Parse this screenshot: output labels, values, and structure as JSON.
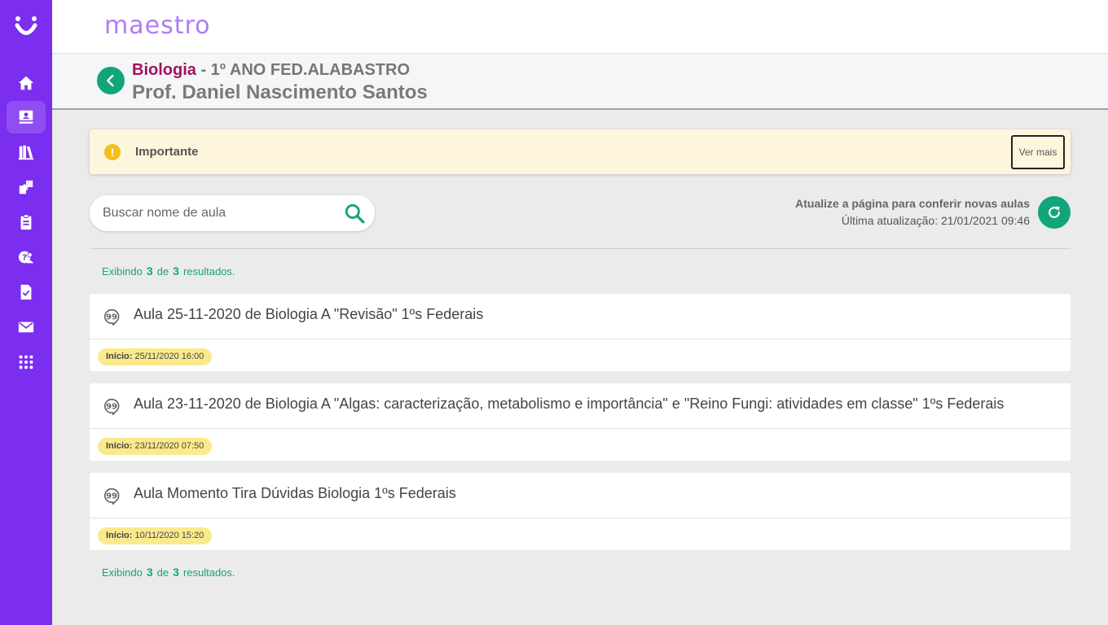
{
  "app": {
    "brand": "maestro"
  },
  "sidebar": {
    "items": [
      {
        "icon": "home-icon"
      },
      {
        "icon": "teacher-board-icon",
        "active": true
      },
      {
        "icon": "library-icon"
      },
      {
        "icon": "puzzle-icon"
      },
      {
        "icon": "clipboard-icon"
      },
      {
        "icon": "mentor-icon"
      },
      {
        "icon": "checked-document-icon"
      },
      {
        "icon": "mail-icon"
      },
      {
        "icon": "apps-grid-icon"
      }
    ]
  },
  "header": {
    "subject": "Biologia",
    "class_name": "1º ANO FED.ALABASTRO",
    "separator": " - ",
    "teacher": "Prof. Daniel Nascimento Santos"
  },
  "notice": {
    "icon_text": "!",
    "title": "Importante",
    "button_label": "Ver mais"
  },
  "search": {
    "placeholder": "Buscar nome de aula",
    "value": ""
  },
  "refresh": {
    "title": "Atualize a página para conferir novas aulas",
    "last_update": "Última atualização: 21/01/2021 09:46"
  },
  "results": {
    "prefix": "Exibindo",
    "shown": "3",
    "middle": "de",
    "total": "3",
    "suffix": "resultados."
  },
  "start_label": "Início:",
  "lessons": [
    {
      "title": "Aula 25-11-2020 de Biologia A \"Revisão\" 1ºs Federais",
      "start": "25/11/2020 16:00"
    },
    {
      "title": "Aula 23-11-2020 de Biologia A \"Algas: caracterização, metabolismo e importância\" e \"Reino Fungi: atividades em classe\" 1ºs Federais",
      "start": "23/11/2020 07:50"
    },
    {
      "title": "Aula Momento Tira Dúvidas Biologia 1ºs Federais",
      "start": "10/11/2020 15:20"
    }
  ],
  "colors": {
    "sidebar": "#7b2df0",
    "accent": "#12a57c",
    "subject": "#a0135c",
    "badge": "#fbea8c"
  }
}
